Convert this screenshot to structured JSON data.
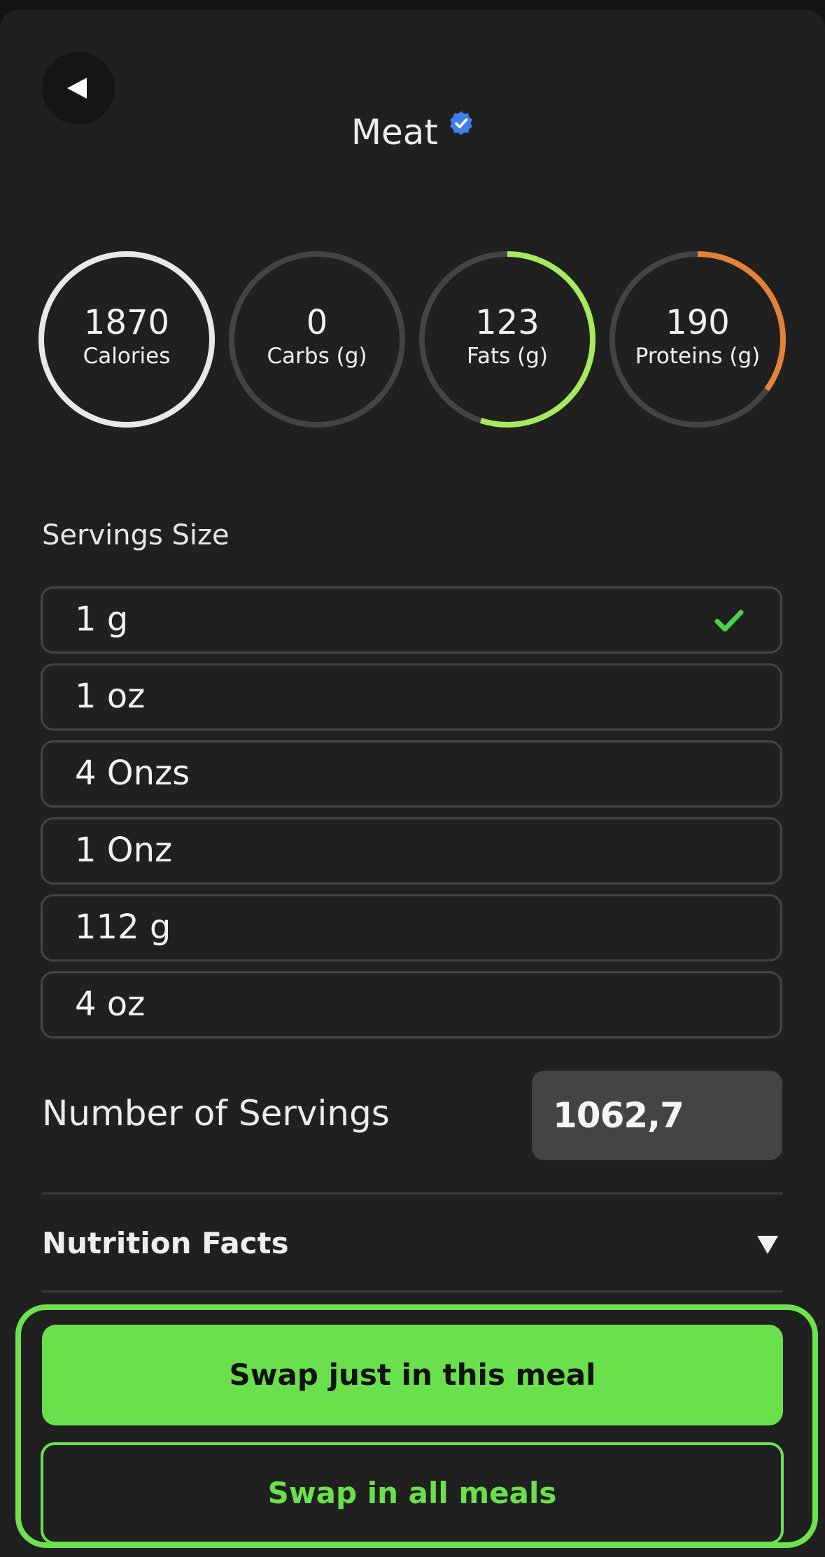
{
  "header": {
    "title": "Meat",
    "verified_icon": "verified-badge-icon",
    "back_icon": "back-arrow-icon"
  },
  "macros": [
    {
      "value": "1870",
      "label": "Calories",
      "fraction": 1.0,
      "color": "#e9e9e9"
    },
    {
      "value": "0",
      "label": "Carbs (g)",
      "fraction": 0.0,
      "color": "#6ae04d"
    },
    {
      "value": "123",
      "label": "Fats (g)",
      "fraction": 0.55,
      "color": "#a6eb5e"
    },
    {
      "value": "190",
      "label": "Proteins (g)",
      "fraction": 0.35,
      "color": "#e5823a"
    }
  ],
  "servings_size": {
    "label": "Servings Size",
    "options": [
      {
        "label": "1 g",
        "selected": true
      },
      {
        "label": "1 oz",
        "selected": false
      },
      {
        "label": "4 Onzs",
        "selected": false
      },
      {
        "label": "1 Onz",
        "selected": false
      },
      {
        "label": "112 g",
        "selected": false
      },
      {
        "label": "4 oz",
        "selected": false
      }
    ]
  },
  "number_of_servings": {
    "label": "Number of Servings",
    "value": "1062,7"
  },
  "nutrition_facts": {
    "label": "Nutrition Facts",
    "icon": "chevron-down-icon"
  },
  "actions": {
    "swap_this_meal": "Swap just in this meal",
    "swap_all_meals": "Swap in all meals"
  },
  "colors": {
    "accent": "#6ae04d",
    "background": "#202020",
    "track": "#444444",
    "verified": "#3f7fea",
    "check": "#4fd04d"
  }
}
